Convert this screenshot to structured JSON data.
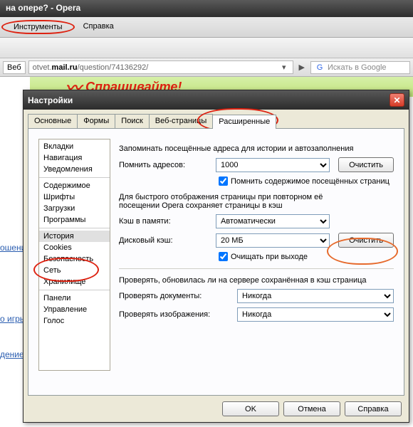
{
  "window": {
    "title": "на опере? - Opera"
  },
  "menubar": {
    "tools": "Инструменты",
    "help": "Справка"
  },
  "address": {
    "web_label": "Веб",
    "url_prefix": "otvet.",
    "url_bold": "mail.ru",
    "url_suffix": "/question/74136292/",
    "search_placeholder": "Искать в Google",
    "g": "G"
  },
  "banner": {
    "text": "Спрашивайте!"
  },
  "side_links": [
    "ошени",
    "о игры",
    "дение"
  ],
  "dialog": {
    "title": "Настройки",
    "tabs": [
      "Основные",
      "Формы",
      "Поиск",
      "Веб-страницы",
      "Расширенные"
    ],
    "leftnav": {
      "g1": [
        "Вкладки",
        "Навигация",
        "Уведомления"
      ],
      "g2": [
        "Содержимое",
        "Шрифты",
        "Загрузки",
        "Программы"
      ],
      "g3": [
        "История",
        "Cookies",
        "Безопасность",
        "Сеть",
        "Хранилище"
      ],
      "g4": [
        "Панели",
        "Управление",
        "Голос"
      ]
    },
    "section1_text": "Запоминать посещённые адреса для истории и автозаполнения",
    "remember_addr_label": "Помнить адресов:",
    "remember_addr_value": "1000",
    "clear_btn": "Очистить",
    "remember_content_chk": "Помнить содержимое посещённых страниц",
    "section2_text": "Для быстрого отображения страницы при повторном её посещении Opera сохраняет страницы в кэш",
    "mem_cache_label": "Кэш в памяти:",
    "mem_cache_value": "Автоматически",
    "disk_cache_label": "Дисковый кэш:",
    "disk_cache_value": "20 МБ",
    "clear_on_exit_chk": "Очищать при выходе",
    "section3_text": "Проверять, обновилась ли на сервере сохранённая в кэш страница",
    "check_docs_label": "Проверять документы:",
    "check_imgs_label": "Проверять изображения:",
    "never": "Никогда",
    "buttons": {
      "ok": "OK",
      "cancel": "Отмена",
      "help": "Справка"
    }
  }
}
